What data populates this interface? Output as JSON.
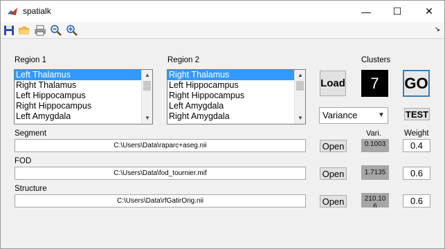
{
  "window": {
    "title": "spatialk",
    "minimize": "—",
    "maximize": "☐",
    "close": "✕"
  },
  "toolbar": {
    "icons": [
      "save-icon",
      "open-folder-icon",
      "print-icon",
      "zoom-out-icon",
      "zoom-in-icon"
    ],
    "overflow": "↘"
  },
  "region1": {
    "label": "Region 1",
    "items": [
      "Left Thalamus",
      "Right Thalamus",
      "Left Hippocampus",
      "Right Hippocampus",
      "Left Amygdala"
    ],
    "selected": 0
  },
  "region2": {
    "label": "Region 2",
    "items": [
      "Right Thalamus",
      "Left Hippocampus",
      "Right Hippocampus",
      "Left Amygdala",
      "Right Amygdala"
    ],
    "selected": 0
  },
  "clusters": {
    "label": "Clusters",
    "value": "7"
  },
  "buttons": {
    "load": "Load",
    "go": "GO",
    "test": "TEST",
    "open": "Open"
  },
  "method": {
    "selected": "Variance"
  },
  "columns": {
    "vari": "Vari.",
    "weight": "Weight"
  },
  "rows": [
    {
      "label": "Segment",
      "path": "C:\\Users\\Data\\raparc+aseg.nii",
      "vari": "0.1003",
      "weight": "0.4"
    },
    {
      "label": "FOD",
      "path": "C:\\Users\\Data\\fod_tournier.mif",
      "vari": "1.7135",
      "weight": "0.6"
    },
    {
      "label": "Structure",
      "path": "C:\\Users\\Data\\rfGatirOrig.nii",
      "vari": "210.10\n6",
      "weight": "0.6"
    }
  ],
  "colors": {
    "selection": "#3399ff",
    "go_border": "#3c7fb1",
    "vari_bg": "#a6a6a6"
  }
}
